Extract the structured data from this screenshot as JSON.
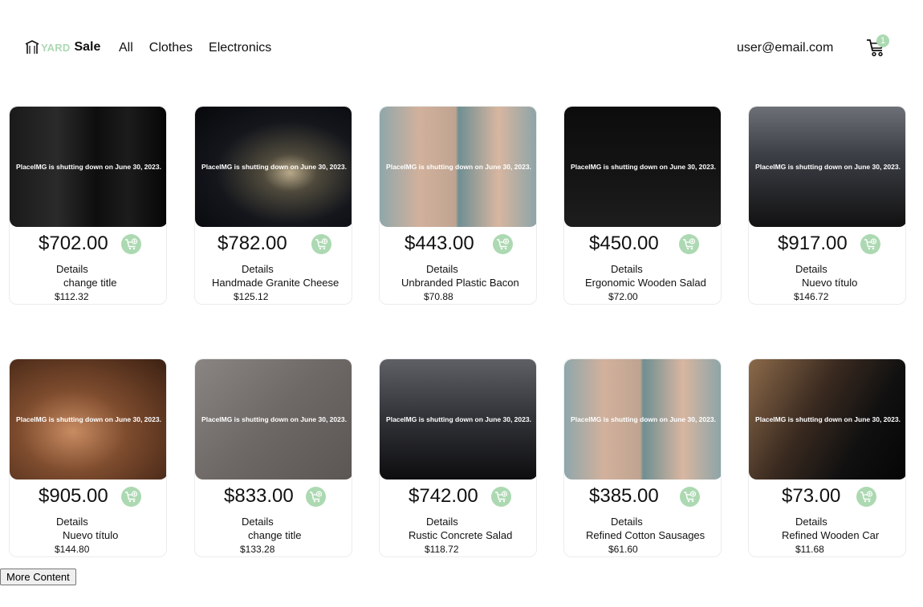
{
  "header": {
    "logo_yard": "YARD",
    "logo_sale": "Sale",
    "nav": [
      "All",
      "Clothes",
      "Electronics"
    ],
    "user_email": "user@email.com",
    "cart_count": "1",
    "cart_icon": "shopping-cart-icon",
    "accent_color": "#acd9b2"
  },
  "products": [
    {
      "image_text": "PlaceIMG is shutting down on June 30, 2023.",
      "price": "$702.00",
      "details_label": "Details",
      "title": "change title",
      "subprice": "$112.32"
    },
    {
      "image_text": "PlaceIMG is shutting down on June 30, 2023.",
      "price": "$782.00",
      "details_label": "Details",
      "title": "Handmade Granite Cheese",
      "subprice": "$125.12"
    },
    {
      "image_text": "PlaceIMG is shutting down on June 30, 2023.",
      "price": "$443.00",
      "details_label": "Details",
      "title": "Unbranded Plastic Bacon",
      "subprice": "$70.88"
    },
    {
      "image_text": "PlaceIMG is shutting down on June 30, 2023.",
      "price": "$450.00",
      "details_label": "Details",
      "title": "Ergonomic Wooden Salad",
      "subprice": "$72.00"
    },
    {
      "image_text": "PlaceIMG is shutting down on June 30, 2023.",
      "price": "$917.00",
      "details_label": "Details",
      "title": "Nuevo título",
      "subprice": "$146.72"
    },
    {
      "image_text": "PlaceIMG is shutting down on June 30, 2023.",
      "price": "$905.00",
      "details_label": "Details",
      "title": "Nuevo título",
      "subprice": "$144.80"
    },
    {
      "image_text": "PlaceIMG is shutting down on June 30, 2023.",
      "price": "$833.00",
      "details_label": "Details",
      "title": "change title",
      "subprice": "$133.28"
    },
    {
      "image_text": "PlaceIMG is shutting down on June 30, 2023.",
      "price": "$742.00",
      "details_label": "Details",
      "title": "Rustic Concrete Salad",
      "subprice": "$118.72"
    },
    {
      "image_text": "PlaceIMG is shutting down on June 30, 2023.",
      "price": "$385.00",
      "details_label": "Details",
      "title": "Refined Cotton Sausages",
      "subprice": "$61.60"
    },
    {
      "image_text": "PlaceIMG is shutting down on June 30, 2023.",
      "price": "$73.00",
      "details_label": "Details",
      "title": "Refined Wooden Car",
      "subprice": "$11.68"
    }
  ],
  "add_to_cart_icon": "add-to-cart-icon",
  "more_button": "More Content"
}
